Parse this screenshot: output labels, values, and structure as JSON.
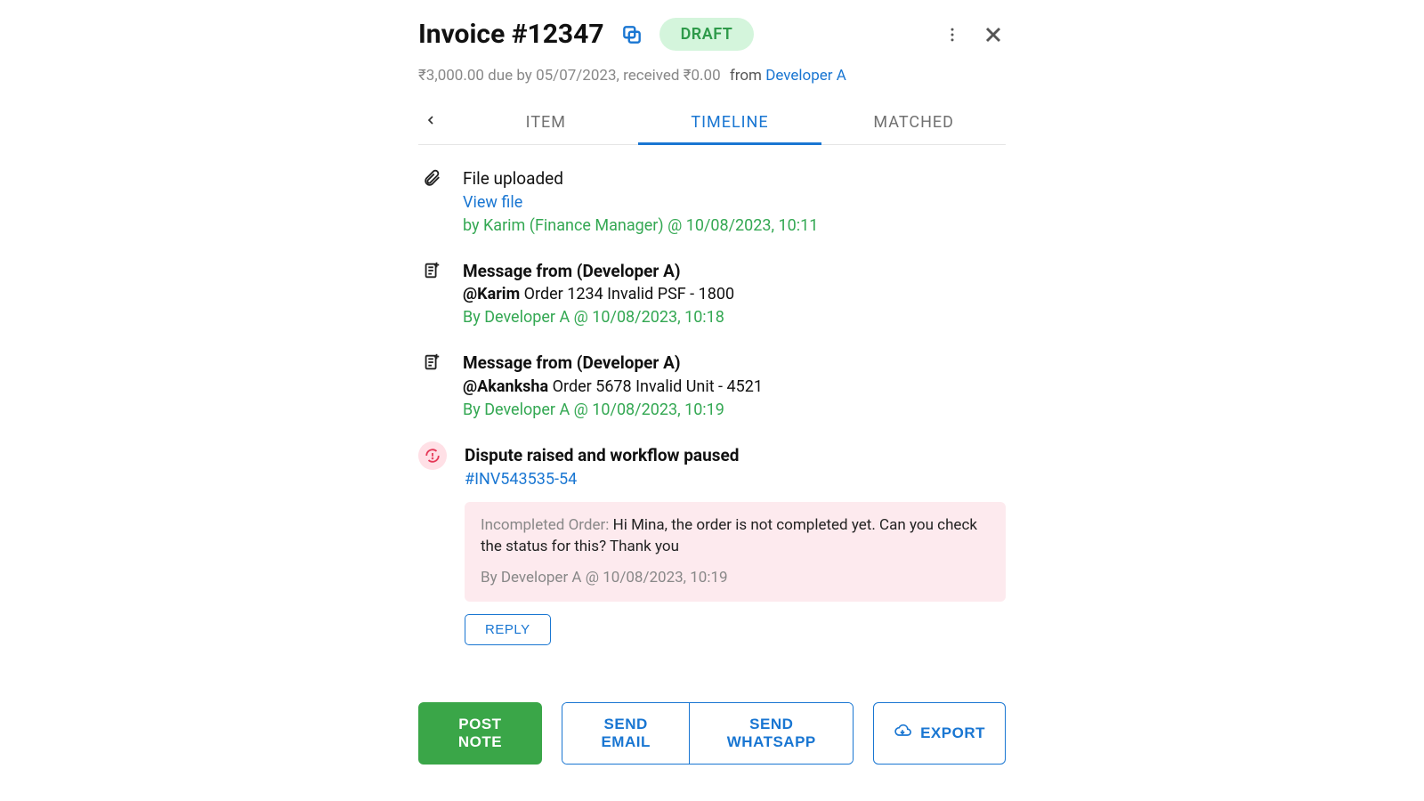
{
  "header": {
    "title": "Invoice #12347",
    "status_badge": "DRAFT",
    "subline_amount": "₹3,000.00 due by 05/07/2023, received ₹0.00",
    "subline_from": "from",
    "subline_party": "Developer A"
  },
  "tabs": {
    "back": "‹",
    "item": "ITEM",
    "timeline": "TIMELINE",
    "matched": "MATCHED"
  },
  "timeline": [
    {
      "icon": "paperclip-icon",
      "title": "File uploaded",
      "link": "View file",
      "meta": "by Karim (Finance Manager) @ 10/08/2023, 10:11"
    },
    {
      "icon": "note-icon",
      "title": "Message from (Developer A)",
      "mention": "@Karim",
      "message_rest": " Order 1234 Invalid PSF - 1800",
      "meta": "By Developer A @ 10/08/2023, 10:18"
    },
    {
      "icon": "note-icon",
      "title": "Message from (Developer A)",
      "mention": "@Akanksha",
      "message_rest": " Order 5678 Invalid Unit - 4521",
      "meta": "By Developer A @ 10/08/2023, 10:19"
    },
    {
      "icon": "alert-icon",
      "title": "Dispute raised and workflow paused",
      "link": "#INV543535-54",
      "box_label": "Incompleted Order: ",
      "box_body": "Hi Mina, the order is not completed yet. Can you check the status for this? Thank you",
      "box_meta": "By Developer A @ 10/08/2023, 10:19",
      "reply": "REPLY"
    }
  ],
  "actions": {
    "post_note": "POST NOTE",
    "send_email": "SEND EMAIL",
    "send_whatsapp": "SEND WHATSAPP",
    "export": "EXPORT"
  }
}
